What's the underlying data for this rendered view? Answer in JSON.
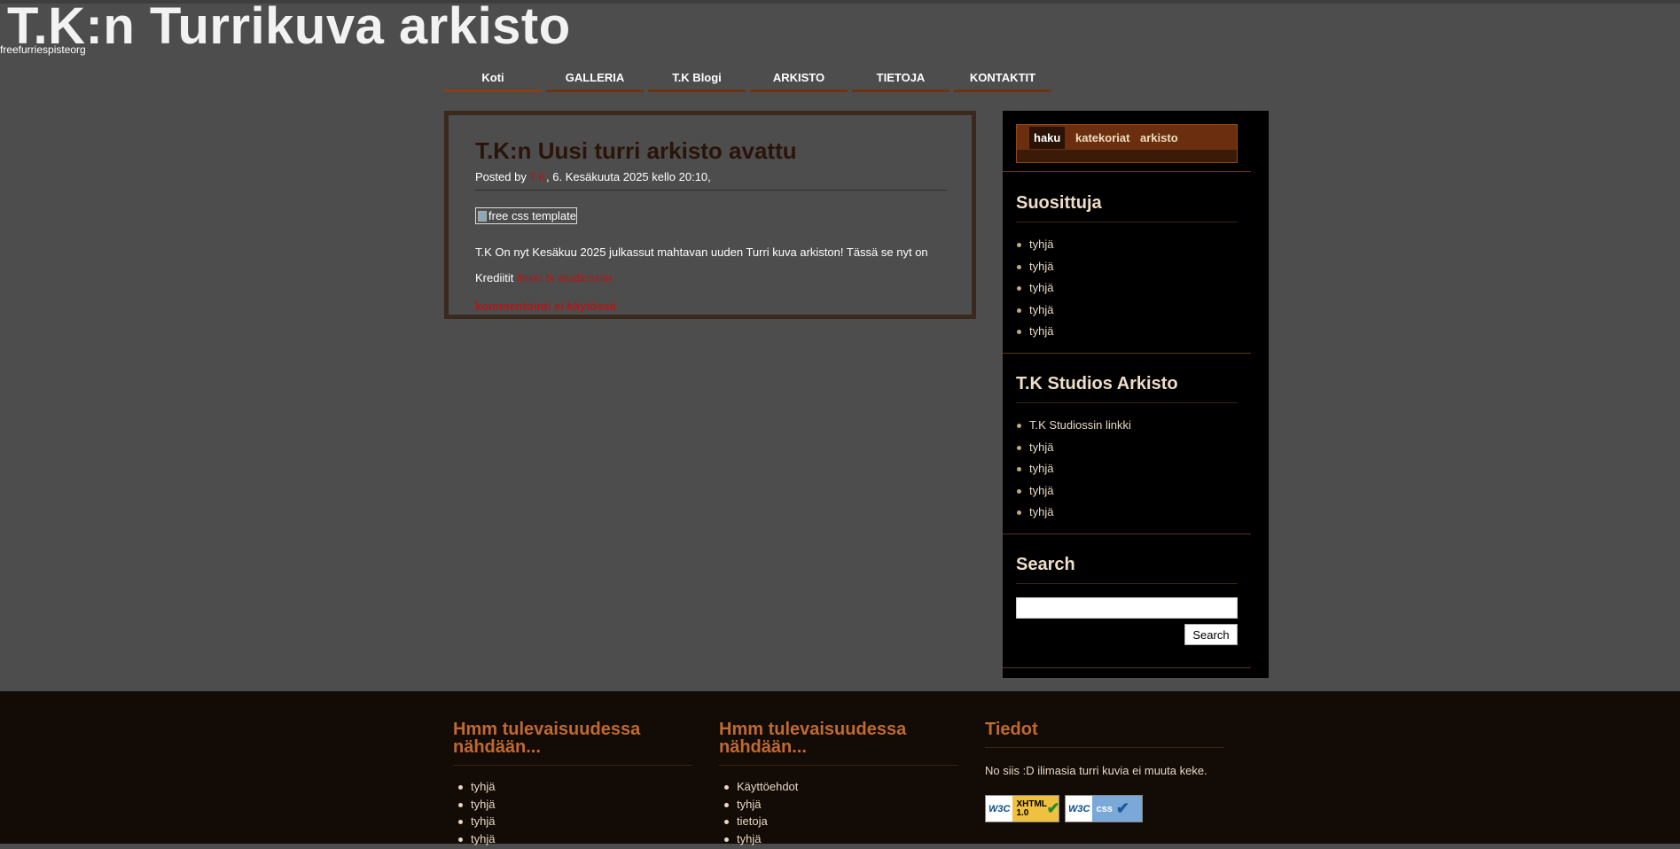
{
  "site": {
    "title": "T.K:n Turrikuva arkisto",
    "tagline": "freefurriespisteorg"
  },
  "nav": [
    {
      "label": "Koti"
    },
    {
      "label": "GALLERIA"
    },
    {
      "label": "T.K Blogi"
    },
    {
      "label": "ARKISTO"
    },
    {
      "label": "TIETOJA"
    },
    {
      "label": "KONTAKTIT"
    }
  ],
  "post": {
    "title": "T.K:n Uusi turri arkisto avattu",
    "posted_by": "Posted by",
    "author": "T.K",
    "date": ", 6. Kesäkuuta 2025 kello 20:10,",
    "image_alt": "free css template",
    "body": "T.K On nyt Kesäkuu 2025 julkassut mahtavan uuden Turri kuva arkiston! Tässä se nyt on",
    "credits_label": "Krediitit",
    "credits_link": "linkki tk studiossiin",
    "comments": "kommentointi ei käytössä"
  },
  "sidebar": {
    "tabs": [
      "haku",
      "katekoriat",
      "arkisto"
    ],
    "popular": {
      "title": "Suosittuja",
      "items": [
        "tyhjä",
        "tyhjä",
        "tyhjä",
        "tyhjä",
        "tyhjä"
      ]
    },
    "archive": {
      "title": "T.K Studios Arkisto",
      "items": [
        "T.K Studiossin linkki",
        "tyhjä",
        "tyhjä",
        "tyhjä",
        "tyhjä"
      ]
    },
    "search": {
      "title": "Search",
      "button": "Search",
      "value": ""
    }
  },
  "footer": {
    "col1": {
      "title": "Hmm tulevaisuudessa nähdään...",
      "items": [
        "tyhjä",
        "tyhjä",
        "tyhjä",
        "tyhjä"
      ]
    },
    "col2": {
      "title": "Hmm tulevaisuudessa nähdään...",
      "items": [
        "Käyttöehdot",
        "tyhjä",
        "tietoja",
        "tyhjä"
      ]
    },
    "col3": {
      "title": "Tiedot",
      "text": "No siis :D ilimasia turri kuvia ei muuta keke."
    },
    "badges": [
      {
        "w3": "W3C",
        "label": "XHTML 1.0"
      },
      {
        "w3": "W3C",
        "label": "css"
      }
    ]
  },
  "colors": {
    "page_bg": "#4d4d4d",
    "accent_brown": "#6b2f10",
    "link_red": "#b01818",
    "footer_bg": "#120b06",
    "footer_heading": "#c06a30"
  }
}
